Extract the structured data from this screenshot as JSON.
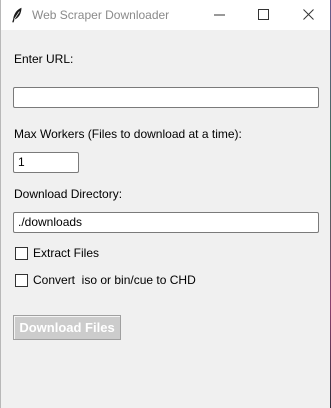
{
  "window": {
    "title": "Web Scraper Downloader",
    "icon": "feather-icon",
    "controls": [
      "minimize-icon",
      "maximize-icon",
      "close-icon"
    ]
  },
  "form": {
    "url_label": "Enter URL:",
    "url_value": "",
    "workers_label": "Max Workers (Files to download at a time):",
    "workers_value": "1",
    "dir_label": "Download Directory:",
    "dir_value": "./downloads",
    "extract_label": "Extract Files",
    "extract_checked": false,
    "convert_label": "Convert  iso or bin/cue to CHD",
    "convert_checked": false,
    "download_button": "Download Files",
    "download_enabled": false
  },
  "colors": {
    "background": "#f0f0f0",
    "titlebar": "#ffffff",
    "disabled_button": "#cccccc"
  }
}
